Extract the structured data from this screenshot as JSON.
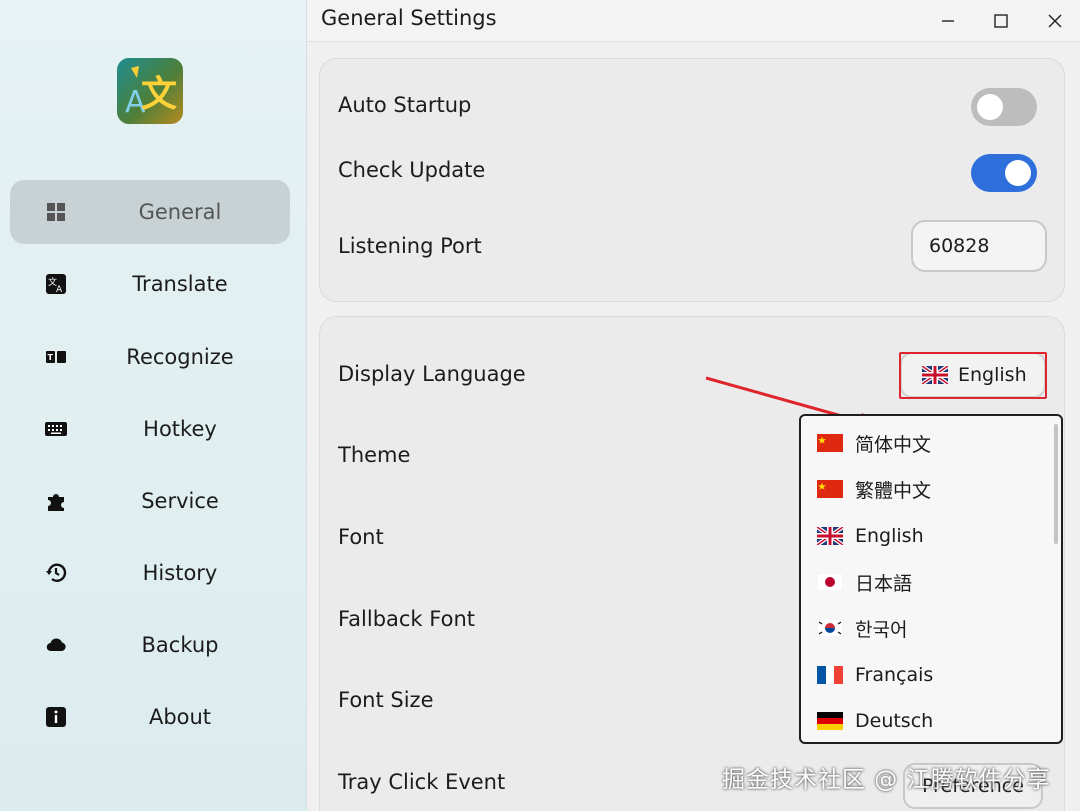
{
  "window": {
    "title": "General Settings"
  },
  "sidebar": {
    "items": [
      {
        "label": "General",
        "icon": "grid-icon"
      },
      {
        "label": "Translate",
        "icon": "translate-icon"
      },
      {
        "label": "Recognize",
        "icon": "text-recognize-icon"
      },
      {
        "label": "Hotkey",
        "icon": "keyboard-icon"
      },
      {
        "label": "Service",
        "icon": "puzzle-icon"
      },
      {
        "label": "History",
        "icon": "history-icon"
      },
      {
        "label": "Backup",
        "icon": "cloud-icon"
      },
      {
        "label": "About",
        "icon": "info-icon"
      }
    ]
  },
  "general": {
    "auto_startup": {
      "label": "Auto Startup",
      "enabled": false
    },
    "check_update": {
      "label": "Check Update",
      "enabled": true
    },
    "listening_port": {
      "label": "Listening Port",
      "value": "60828"
    }
  },
  "appearance": {
    "display_language": {
      "label": "Display Language",
      "value": "English"
    },
    "theme": {
      "label": "Theme"
    },
    "font": {
      "label": "Font"
    },
    "fallback_font": {
      "label": "Fallback Font"
    },
    "font_size": {
      "label": "Font Size"
    },
    "tray_click_event": {
      "label": "Tray Click Event",
      "value": "Preference"
    }
  },
  "language_dropdown": {
    "options": [
      {
        "label": "简体中文",
        "flag": "cn-flag"
      },
      {
        "label": "繁體中文",
        "flag": "cn-flag"
      },
      {
        "label": "English",
        "flag": "uk-flag"
      },
      {
        "label": "日本語",
        "flag": "jp-flag"
      },
      {
        "label": "한국어",
        "flag": "kr-flag"
      },
      {
        "label": "Français",
        "flag": "fr-flag"
      },
      {
        "label": "Deutsch",
        "flag": "de-flag"
      }
    ]
  },
  "watermark": {
    "text": "掘金技术社区 @ 江腾软件分享"
  },
  "colors": {
    "accent": "#2f6fdb",
    "highlight": "#e0242c",
    "toggle_off": "#bdbdbd"
  }
}
